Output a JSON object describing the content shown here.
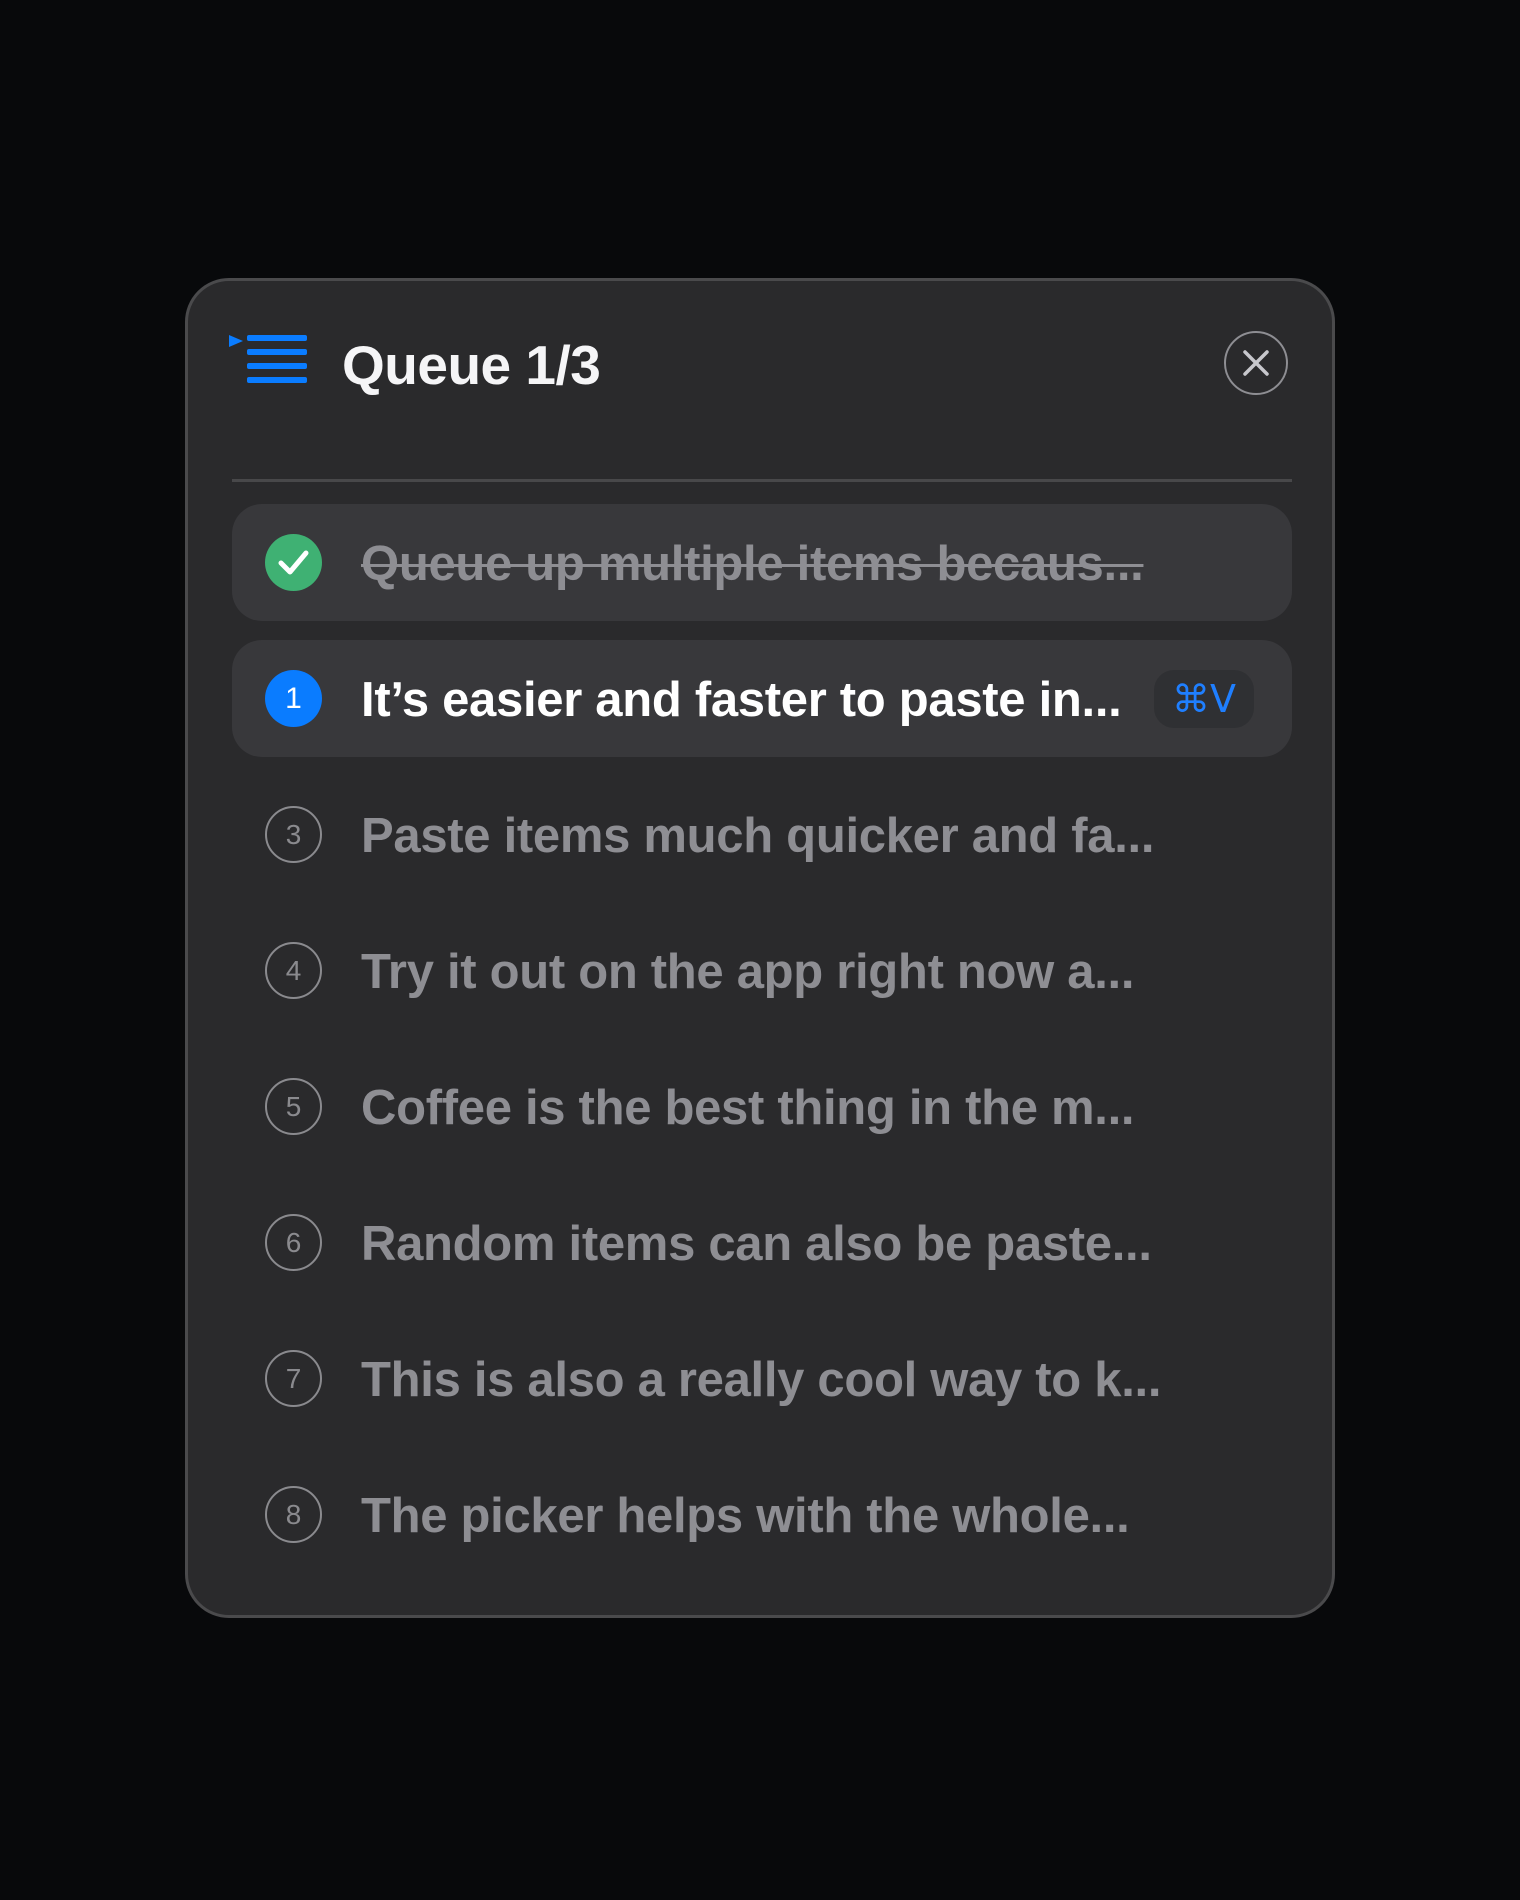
{
  "header": {
    "title": "Queue 1/3",
    "icon": "queue-list-icon",
    "close_icon": "close-icon"
  },
  "colors": {
    "accent": "#0a7cff",
    "success": "#3fb173",
    "panel": "#2a2a2c",
    "row_highlight": "#38383b"
  },
  "items": [
    {
      "state": "done",
      "marker": "",
      "text": "Queue up multiple items becaus..."
    },
    {
      "state": "current",
      "marker": "1",
      "text": "It’s easier and faster to paste in...",
      "shortcut": "⌘V"
    },
    {
      "state": "pending",
      "marker": "3",
      "text": "Paste items much quicker and fa..."
    },
    {
      "state": "pending",
      "marker": "4",
      "text": "Try it out on the app right now a..."
    },
    {
      "state": "pending",
      "marker": "5",
      "text": "Coffee is the best thing in the m..."
    },
    {
      "state": "pending",
      "marker": "6",
      "text": "Random items can also be paste..."
    },
    {
      "state": "pending",
      "marker": "7",
      "text": "This is also a really cool way to k..."
    },
    {
      "state": "pending",
      "marker": "8",
      "text": "The picker helps with the whole..."
    }
  ]
}
